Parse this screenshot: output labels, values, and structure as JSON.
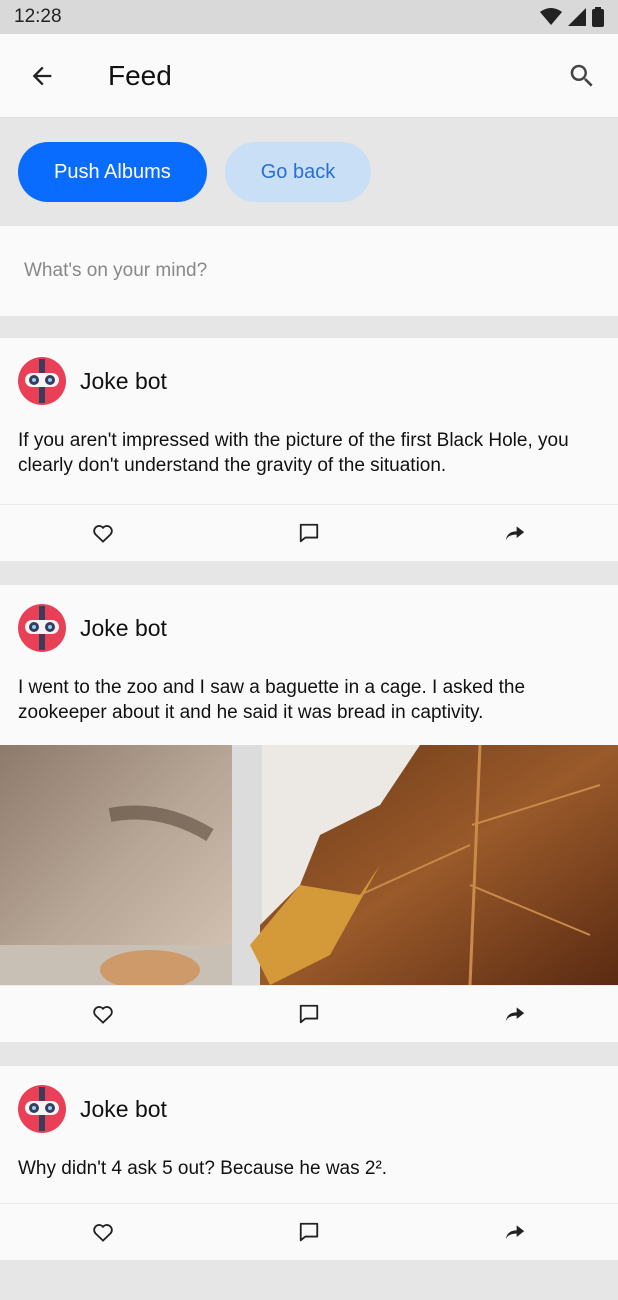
{
  "status_bar": {
    "time": "12:28"
  },
  "app_bar": {
    "title": "Feed"
  },
  "chips": {
    "primary_label": "Push Albums",
    "secondary_label": "Go back"
  },
  "composer": {
    "placeholder": "What's on your mind?"
  },
  "posts": [
    {
      "author": "Joke bot",
      "text": "If you aren't impressed with the picture of the first Black Hole, you clearly don't understand the gravity of the situation.",
      "has_image": false
    },
    {
      "author": "Joke bot",
      "text": "I went to the zoo and I saw a baguette in a cage. I asked the zookeeper about it and he said it was bread in captivity.",
      "has_image": true
    },
    {
      "author": "Joke bot",
      "text": "Why didn't 4 ask 5 out? Because he was 2².",
      "has_image": false
    }
  ],
  "icons": {
    "back": "arrow-left-icon",
    "search": "search-icon",
    "like": "heart-icon",
    "comment": "comment-icon",
    "share": "share-icon",
    "wifi": "wifi-icon",
    "signal": "signal-icon",
    "battery": "battery-icon"
  }
}
